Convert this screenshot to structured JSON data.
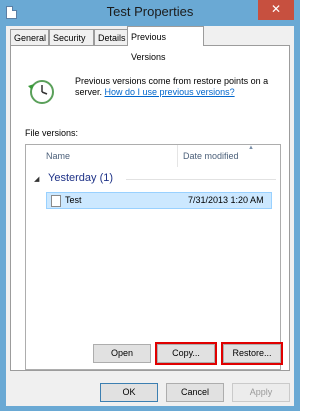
{
  "window": {
    "title": "Test Properties",
    "close_glyph": "✕"
  },
  "tabs": [
    {
      "label": "General"
    },
    {
      "label": "Security"
    },
    {
      "label": "Details"
    },
    {
      "label": "Previous Versions"
    }
  ],
  "panel": {
    "description": "Previous versions come from restore points on a server.",
    "help_link": "How do I use previous versions?",
    "file_versions_label": "File versions:",
    "columns": {
      "name": "Name",
      "date": "Date modified"
    },
    "group": {
      "label": "Yesterday (1)"
    },
    "rows": [
      {
        "name": "Test",
        "date": "7/31/2013 1:20 AM"
      }
    ],
    "buttons": {
      "open": "Open",
      "copy": "Copy...",
      "restore": "Restore..."
    }
  },
  "footer": {
    "ok": "OK",
    "cancel": "Cancel",
    "apply": "Apply"
  },
  "colors": {
    "frame": "#6aa9d4",
    "close": "#c7503f",
    "link": "#0066cc",
    "selection": "#cce8ff",
    "highlight": "#e00000"
  },
  "icons": {
    "restore": "clock-restore-icon",
    "file": "document-icon"
  }
}
